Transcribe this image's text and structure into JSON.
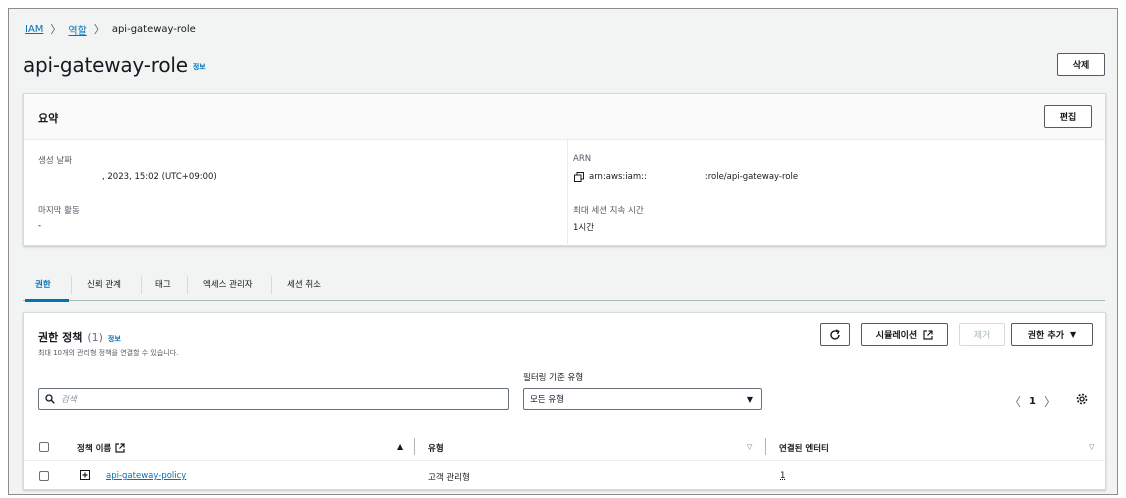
{
  "breadcrumb": {
    "root": "IAM",
    "level2": "역할",
    "current": "api-gateway-role"
  },
  "page": {
    "title": "api-gateway-role",
    "info": "정보",
    "delete_label": "삭제"
  },
  "summary": {
    "heading": "요약",
    "edit_label": "편집",
    "created_label": "생성 날짜",
    "created_value": ", 2023, 15:02 (UTC+09:00)",
    "arn_label": "ARN",
    "arn_prefix": "arn:aws:iam::",
    "arn_suffix": ":role/api-gateway-role",
    "last_activity_label": "마지막 활동",
    "last_activity_value": "-",
    "max_session_label": "최대 세션 지속 시간",
    "max_session_value": "1시간"
  },
  "tabs": [
    "권한",
    "신뢰 관계",
    "태그",
    "엑세스 관리자",
    "세션 취소"
  ],
  "policies": {
    "heading": "권한 정책",
    "count": "(1)",
    "info": "정보",
    "description": "최대 10개의 관리형 정책을 연결할 수 있습니다.",
    "simulate_label": "시뮬레이션",
    "remove_label": "제거",
    "add_label": "권한 추가",
    "filter_label": "필터링 기준 유형",
    "search_placeholder": "검색",
    "filter_value": "모든 유형",
    "page_number": "1",
    "columns": [
      "정책 이름",
      "유형",
      "연결된 엔터티"
    ],
    "rows": [
      {
        "name": "api-gateway-policy",
        "type": "고객 관리형",
        "entities": "1"
      }
    ]
  },
  "colors": {
    "accent": "#0073bb",
    "border": "#d5dbdb",
    "text": "#16191f"
  }
}
